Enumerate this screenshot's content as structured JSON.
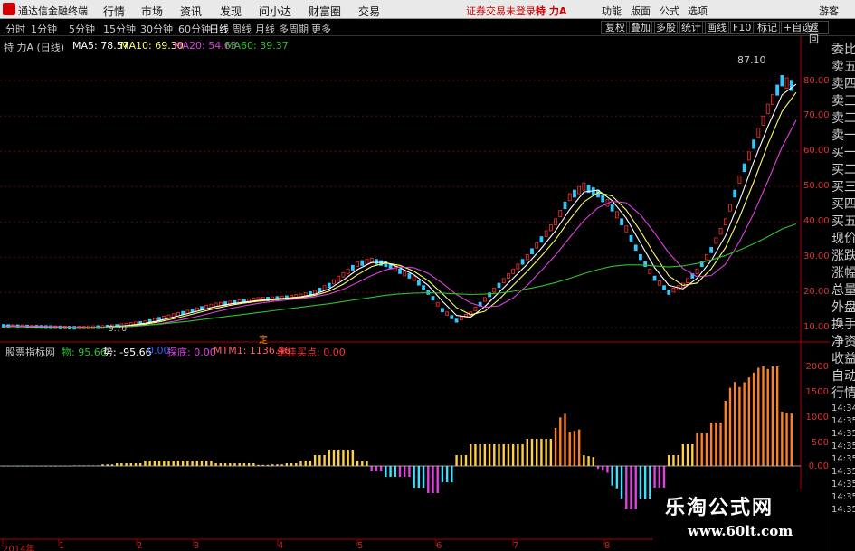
{
  "app": {
    "title": "通达信金融终端"
  },
  "menu": [
    "行情",
    "市场",
    "资讯",
    "发现",
    "问小达",
    "财富圈",
    "交易"
  ],
  "trade_status": "证券交易未登录",
  "stock_title": "特 力A",
  "right_buttons": [
    "功能",
    "版面",
    "公式",
    "选项",
    "游客"
  ],
  "periods": [
    "分时",
    "1分钟",
    "5分钟",
    "15分钟",
    "30分钟",
    "60分钟",
    "日线",
    "周线",
    "月线",
    "多周期",
    "更多"
  ],
  "tools": [
    "复权",
    "叠加",
    "多股",
    "统计",
    "画线",
    "F10",
    "标记",
    "+自选",
    "返回"
  ],
  "main_labels": {
    "name": "特 力A (日线)",
    "ma5": "MA5: 78.57",
    "ma10": "MA10: 69.30",
    "ma20": "MA20: 54.63",
    "ma60": "MA60: 39.37",
    "peak": "87.10",
    "low": "9.70",
    "marker": "定"
  },
  "price_axis": [
    "80.00",
    "70.00",
    "60.00",
    "50.00",
    "40.00",
    "30.00",
    "20.00",
    "10.00"
  ],
  "indicator": {
    "name": "股票指标网",
    "a": "物: 95.66",
    "b": "势: -95.66",
    "c": "0.00",
    "d": "探底: 0.00",
    "e": "MTM1: 1136.46",
    "f": "绝佳买点: 0.00",
    "axis": [
      "2000",
      "1500",
      "1000",
      "500",
      "0.00"
    ]
  },
  "sidebar": [
    "委比",
    "卖五",
    "卖四",
    "卖三",
    "卖二",
    "卖一",
    "买一",
    "买二",
    "买三",
    "买四",
    "买五",
    "现价",
    "涨跌",
    "涨幅",
    "总量",
    "外盘",
    "换手",
    "净资",
    "收益",
    "自动",
    "行情",
    "14:34",
    "14:35",
    "14:35",
    "14:35",
    "14:35",
    "14:35",
    "14:35",
    "14:35",
    "14:35"
  ],
  "x_axis": [
    "2014年",
    "1",
    "2",
    "3",
    "4",
    "5",
    "6",
    "7",
    "8"
  ],
  "watermark": {
    "cn": "乐淘公式网",
    "url": "www.60lt.com"
  },
  "colors": {
    "up": "#ff3030",
    "down": "#30c8ff",
    "ma5": "#ffffff",
    "ma10": "#ffff66",
    "ma20": "#e040e0",
    "ma60": "#30c030"
  },
  "chart_data": {
    "type": "line",
    "price_series": [
      10.5,
      10.4,
      10.3,
      10.2,
      10.1,
      10,
      10.1,
      10.2,
      10.5,
      11,
      11.5,
      12.5,
      13.5,
      14.5,
      15.5,
      16.5,
      17,
      17.5,
      18,
      18.2,
      18.5,
      19,
      20,
      22,
      25,
      28,
      29,
      28,
      26,
      24,
      20,
      15,
      12,
      14,
      18,
      22,
      26,
      30,
      35,
      40,
      47,
      50,
      48,
      44,
      38,
      30,
      24,
      20,
      22,
      26,
      32,
      40,
      52,
      62,
      72,
      80,
      78
    ],
    "ma60_series": [
      10,
      10,
      10,
      10,
      10,
      10,
      10,
      10,
      10.2,
      10.4,
      10.7,
      11,
      11.4,
      11.8,
      12.3,
      12.8,
      13.3,
      13.8,
      14.3,
      14.8,
      15.3,
      15.8,
      16.3,
      16.8,
      17.4,
      18,
      18.6,
      19.2,
      19.6,
      19.8,
      19.9,
      19.8,
      19.6,
      19.4,
      19.5,
      19.8,
      20.3,
      21,
      21.8,
      22.8,
      24,
      25.3,
      26.5,
      27.4,
      27.8,
      27.8,
      27.5,
      27.2,
      27.5,
      28.2,
      29.2,
      30.5,
      32,
      33.8,
      35.8,
      38,
      39.4
    ]
  }
}
